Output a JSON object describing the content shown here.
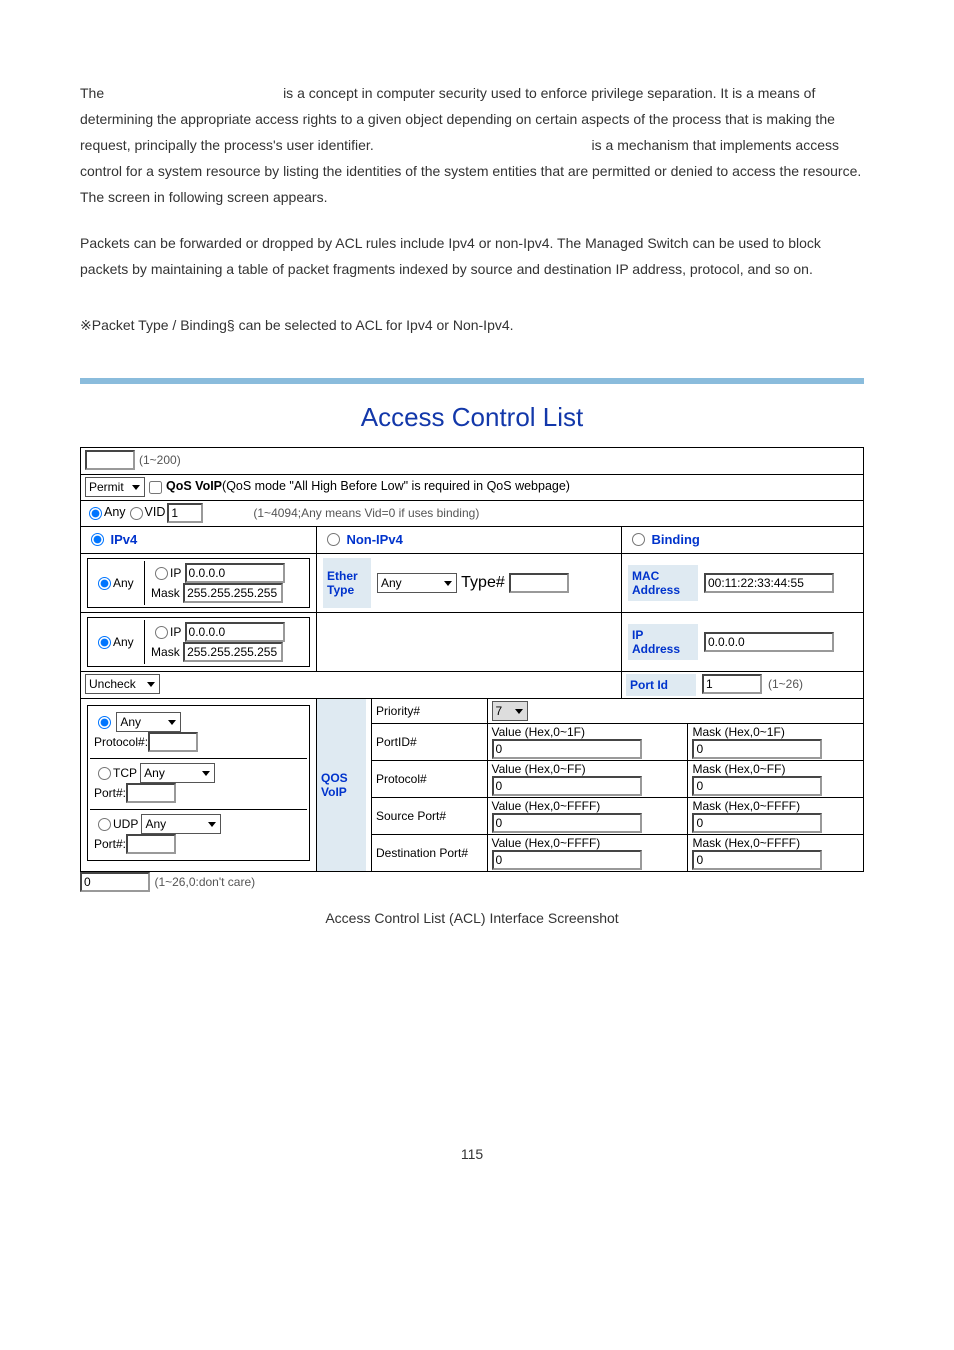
{
  "intro": {
    "p1a": "The",
    "p1b": "is a concept in computer security used to enforce privilege separation. It is a means of determining the appropriate access rights to a given object depending on certain aspects of the process that is making the request, principally the process's user identifier.",
    "p1c": "is a mechanism that implements access control for a system resource by listing the identities of the system entities that are permitted or denied to access the resource. The screen in following screen appears.",
    "p2": "Packets can be forwarded or dropped by ACL rules include Ipv4 or non-Ipv4. The Managed Switch can be used to block packets by maintaining a table of packet fragments indexed by source and destination IP address, protocol, and so on.",
    "p3": "※Packet Type / Binding§ can be selected to ACL for Ipv4 or Non-Ipv4."
  },
  "ss": {
    "title": "Access Control List",
    "group_range": "(1~200)",
    "action_sel": "Permit",
    "qos_voip_label": "QoS VoIP",
    "qos_voip_desc": "(QoS mode \"All High Before Low\" is required in QoS webpage)",
    "any_label": "Any",
    "vid_label": "VID",
    "vid_val": "1",
    "vid_desc": "(1~4094;Any means Vid=0 if uses binding)",
    "col_ipv4": "IPv4",
    "col_nonipv4": "Non-IPv4",
    "col_binding": "Binding",
    "ip_any": "Any",
    "ip_lbl": "IP",
    "ip1_val": "0.0.0.0",
    "mask_lbl": "Mask",
    "mask1_val": "255.255.255.255",
    "ip2_val": "0.0.0.0",
    "mask2_val": "255.255.255.255",
    "ether_type_lbl": "Ether Type",
    "ether_type_sel": "Any",
    "type_hash": "Type#",
    "mac_addr_lbl": "MAC Address",
    "mac_addr_val": "00:11:22:33:44:55",
    "ip_addr_lbl": "IP Address",
    "ip_addr_val": "0.0.0.0",
    "uncheck_sel": "Uncheck",
    "portid_lbl": "Port Id",
    "portid_val": "1",
    "portid_range": "(1~26)",
    "proto_any_sel": "Any",
    "proto_hash": "Protocol#:",
    "tcp_lbl": "TCP",
    "tcp_sel": "Any",
    "tcp_port": "Port#:",
    "udp_lbl": "UDP",
    "udp_sel": "Any",
    "udp_port": "Port#:",
    "qos_voip_col": "QOS VoIP",
    "priority_lbl": "Priority#",
    "priority_sel": "7",
    "portid2_lbl": "PortID#",
    "value_1f": "Value (Hex,0~1F)",
    "mask_1f": "Mask (Hex,0~1F)",
    "proto2_lbl": "Protocol#",
    "value_ff": "Value (Hex,0~FF)",
    "mask_ff": "Mask (Hex,0~FF)",
    "srcport_lbl": "Source Port#",
    "value_ffff": "Value (Hex,0~FFFF)",
    "mask_ffff": "Mask (Hex,0~FFFF)",
    "dstport_lbl": "Destination Port#",
    "zero": "0",
    "bottom_val": "0",
    "bottom_range": "(1~26,0:don't care)"
  },
  "caption": "Access Control List (ACL) Interface Screenshot",
  "page_num": "115"
}
